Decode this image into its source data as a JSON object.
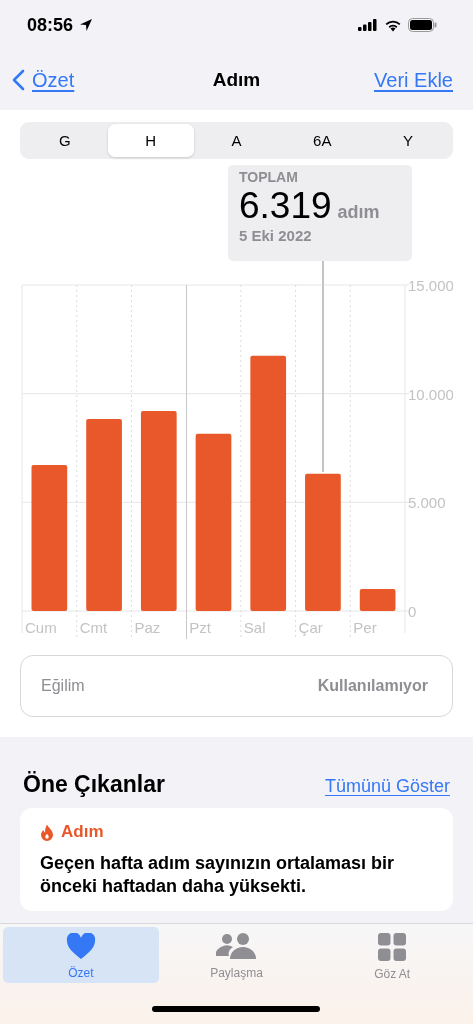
{
  "status_bar": {
    "time": "08:56"
  },
  "nav": {
    "back": "Özet",
    "title": "Adım",
    "action": "Veri Ekle"
  },
  "segments": [
    {
      "label": "G",
      "selected": false
    },
    {
      "label": "H",
      "selected": true
    },
    {
      "label": "A",
      "selected": false
    },
    {
      "label": "6A",
      "selected": false
    },
    {
      "label": "Y",
      "selected": false
    }
  ],
  "summary": {
    "label": "TOPLAM",
    "value": "6.319",
    "unit": "adım",
    "date": "5 Eki 2022"
  },
  "chart_data": {
    "type": "bar",
    "categories": [
      "Cum",
      "Cmt",
      "Paz",
      "Pzt",
      "Sal",
      "Çar",
      "Per"
    ],
    "annotations": [
      {
        "x": "Çar"
      }
    ],
    "series": [
      {
        "color": "#e8582a",
        "values": [
          6720,
          8840,
          9200,
          8150,
          11740,
          6319,
          1010
        ]
      }
    ],
    "ylim": [
      0,
      15000
    ],
    "yticks": [
      {
        "value": 0,
        "label": "0"
      },
      {
        "value": 5000,
        "label": "5.000"
      },
      {
        "value": 10000,
        "label": "10.000"
      },
      {
        "value": 15000,
        "label": "15.000"
      }
    ]
  },
  "trend": {
    "label": "Eğilim",
    "value": "Kullanılamıyor"
  },
  "highlights": {
    "title": "Öne Çıkanlar",
    "link": "Tümünü Göster",
    "card": {
      "category": "Adım",
      "text": "Geçen hafta adım sayınızın ortalaması bir önceki haftadan daha yüksekti."
    }
  },
  "tab_bar": [
    {
      "label": "Özet",
      "selected": true
    },
    {
      "label": "Paylaşma",
      "selected": false
    },
    {
      "label": "Göz At",
      "selected": false
    }
  ]
}
